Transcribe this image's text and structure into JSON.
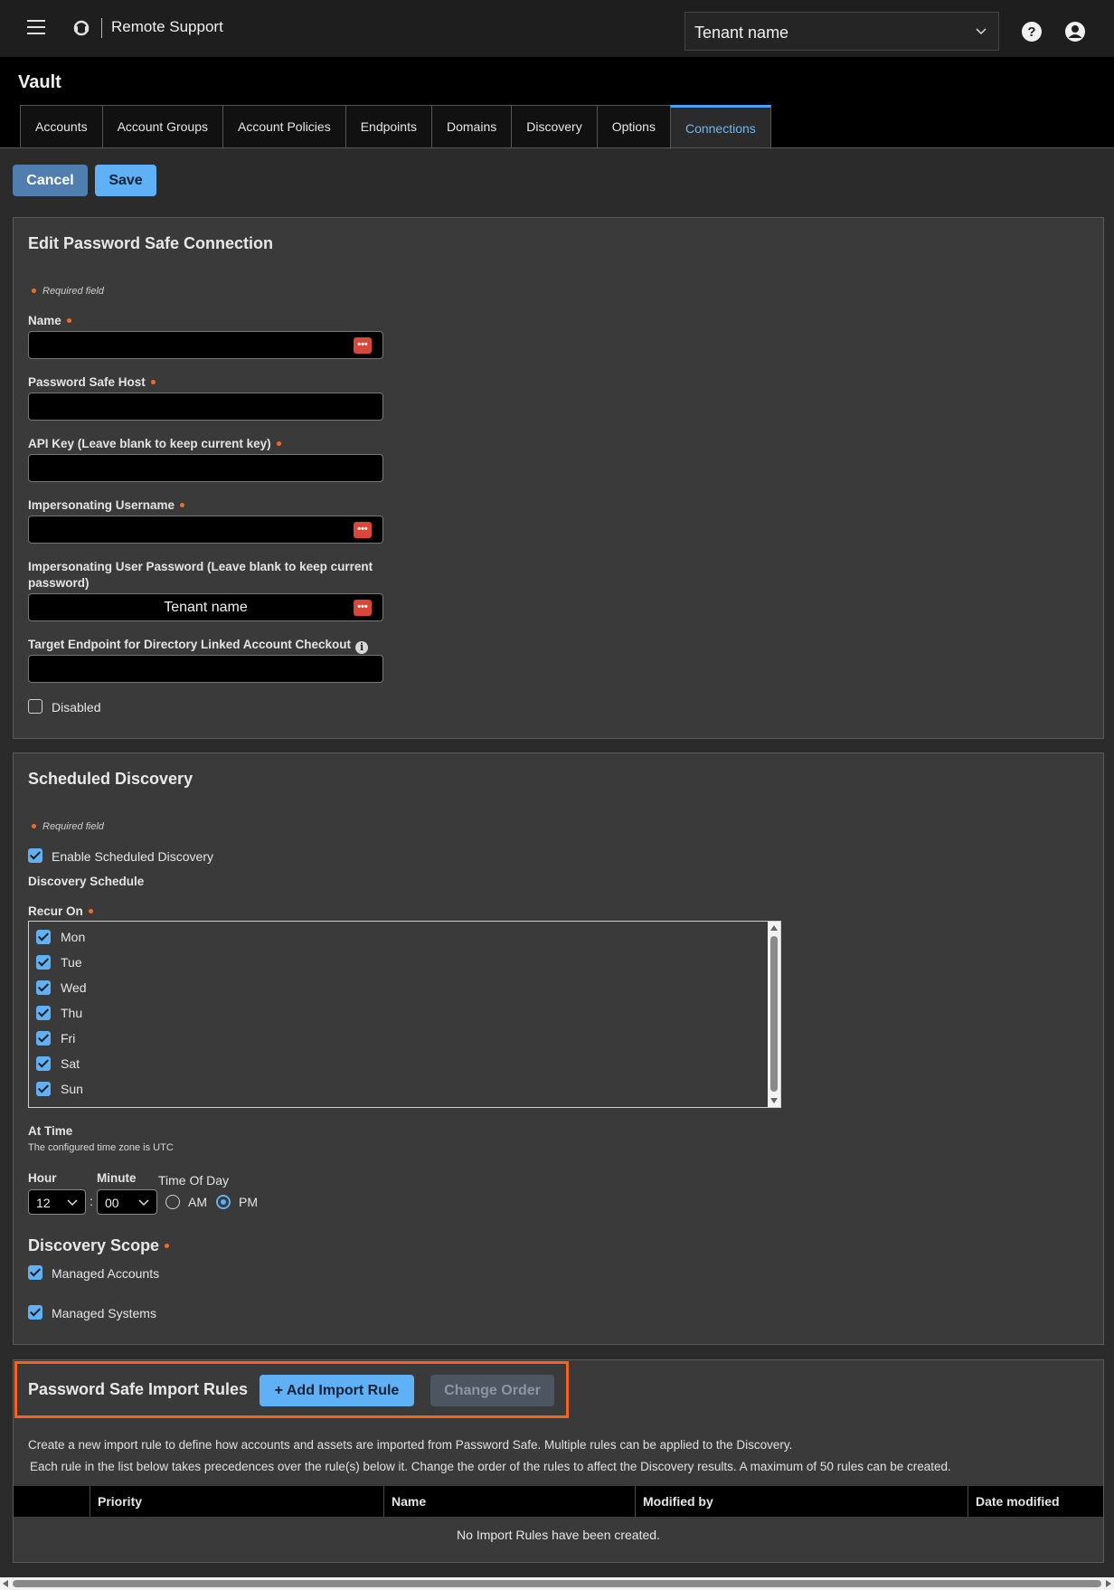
{
  "app": {
    "brand": "Remote Support",
    "tenant_select": "Tenant name"
  },
  "vault": {
    "title": "Vault",
    "tabs": [
      {
        "label": "Accounts"
      },
      {
        "label": "Account Groups"
      },
      {
        "label": "Account Policies"
      },
      {
        "label": "Endpoints"
      },
      {
        "label": "Domains"
      },
      {
        "label": "Discovery"
      },
      {
        "label": "Options"
      },
      {
        "label": "Connections",
        "active": true
      }
    ]
  },
  "actions": {
    "cancel": "Cancel",
    "save": "Save"
  },
  "edit_panel": {
    "title": "Edit Password Safe Connection",
    "required_note": "Required field",
    "fields": {
      "name": {
        "label": "Name",
        "value": ""
      },
      "host": {
        "label": "Password Safe Host",
        "value": ""
      },
      "api_key": {
        "label": "API Key (Leave blank to keep current key)",
        "value": ""
      },
      "imp_user": {
        "label": "Impersonating Username",
        "value": ""
      },
      "imp_pass": {
        "label": "Impersonating User Password (Leave blank to keep current password)",
        "value": "Tenant name"
      },
      "target": {
        "label": "Target Endpoint for Directory Linked Account Checkout",
        "value": ""
      }
    },
    "disabled_label": "Disabled",
    "disabled_checked": false
  },
  "discovery_panel": {
    "title": "Scheduled Discovery",
    "required_note": "Required field",
    "enable_label": "Enable Scheduled Discovery",
    "enable_checked": true,
    "schedule_heading": "Discovery Schedule",
    "recur_label": "Recur On",
    "days": [
      {
        "label": "Mon",
        "checked": true
      },
      {
        "label": "Tue",
        "checked": true
      },
      {
        "label": "Wed",
        "checked": true
      },
      {
        "label": "Thu",
        "checked": true
      },
      {
        "label": "Fri",
        "checked": true
      },
      {
        "label": "Sat",
        "checked": true
      },
      {
        "label": "Sun",
        "checked": true
      }
    ],
    "at_time": "At Time",
    "tz_note": "The configured time zone is UTC",
    "hour_label": "Hour",
    "hour_value": "12",
    "minute_label": "Minute",
    "minute_value": "00",
    "time_sep": ":",
    "tod_label": "Time Of Day",
    "am_label": "AM",
    "pm_label": "PM",
    "selected_tod": "PM",
    "scope_title": "Discovery Scope",
    "scope_items": [
      {
        "label": "Managed Accounts",
        "checked": true
      },
      {
        "label": "Managed Systems",
        "checked": true
      }
    ]
  },
  "rules_panel": {
    "title": "Password Safe Import Rules",
    "add_label": "+ Add Import Rule",
    "change_label": "Change Order",
    "desc1": "Create a new import rule to define how accounts and assets are imported from Password Safe. Multiple rules can be applied to the Discovery.",
    "desc2": "Each rule in the list below takes precedences over the rule(s) below it. Change the order of the rules to affect the Discovery results. A  maximum of 50 rules can be created.",
    "columns": [
      "Priority",
      "Name",
      "Modified by",
      "Date modified"
    ],
    "empty": "No Import Rules have been created."
  },
  "colors": {
    "accent": "#5fb0f5",
    "required": "#f06a2a",
    "highlight": "#f2641f",
    "pm_icon": "#d9473a"
  }
}
